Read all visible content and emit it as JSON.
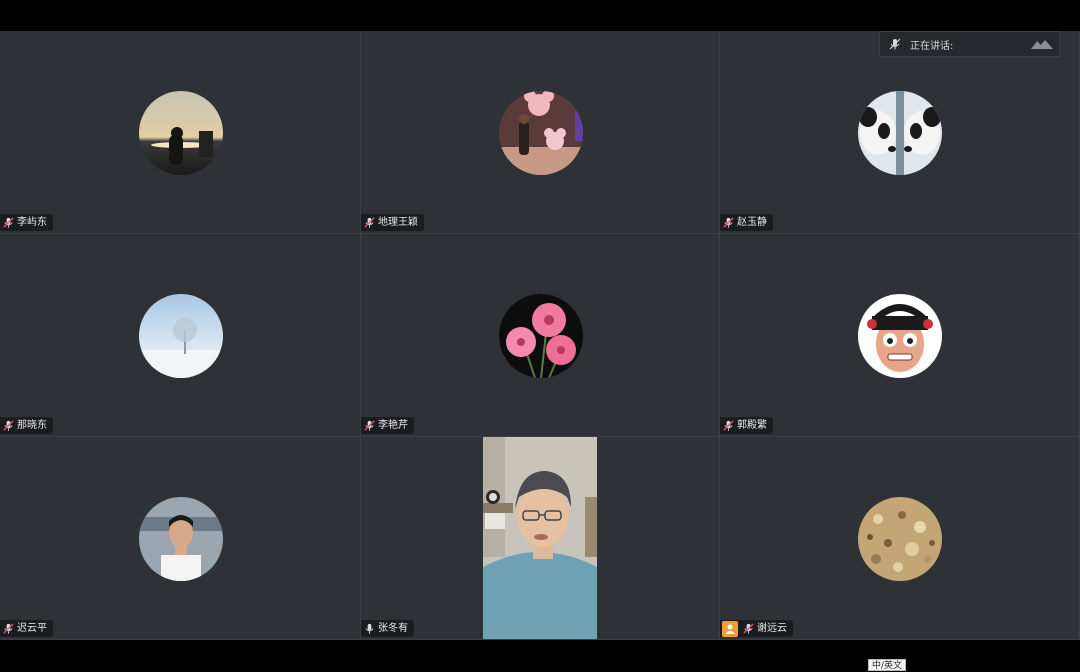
{
  "speaking_panel": {
    "label": "正在讲话:"
  },
  "participants": [
    {
      "name": "李屿东"
    },
    {
      "name": "地理王颖"
    },
    {
      "name": "赵玉静"
    },
    {
      "name": "那晓东"
    },
    {
      "name": "李艳芹"
    },
    {
      "name": "郭殿繁"
    },
    {
      "name": "迟云平"
    },
    {
      "name": "张冬有"
    },
    {
      "name": "谢远云"
    }
  ],
  "taskbar": {
    "ime_label": "中/英文"
  },
  "colors": {
    "tile_bg": "#2e3136",
    "label_bg": "#1a1c1f",
    "muted_mic": "#e05a6a",
    "cam_off_badge": "#f29c38"
  }
}
